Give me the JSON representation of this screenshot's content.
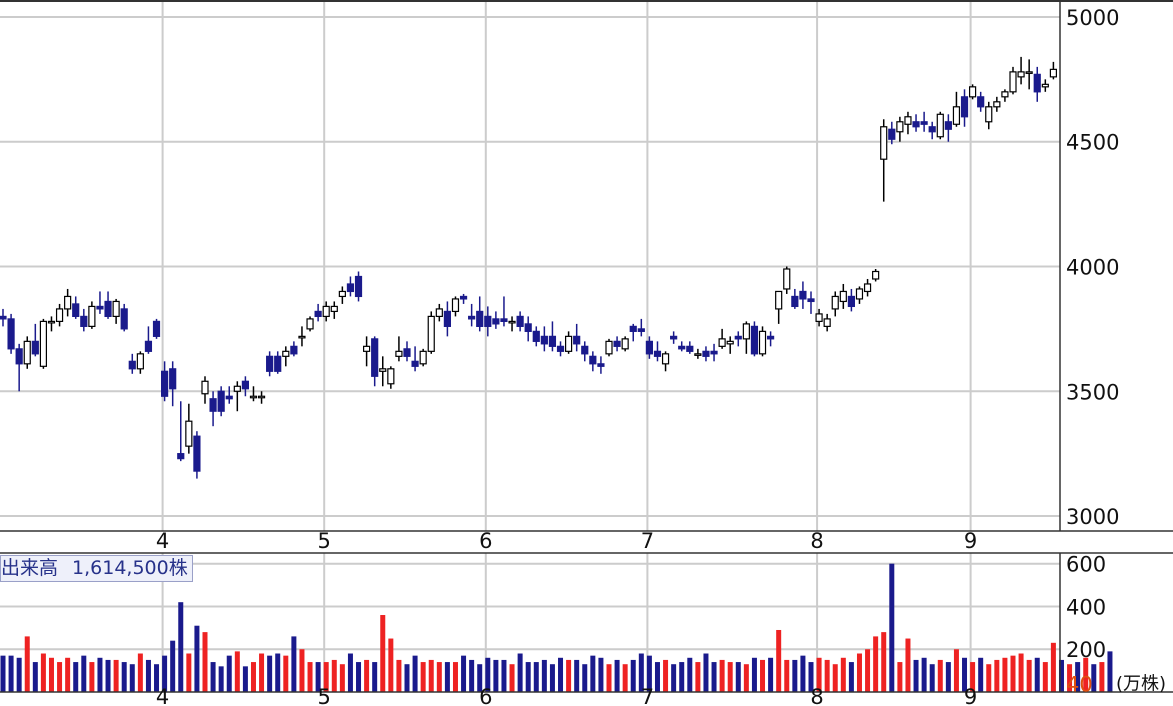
{
  "colors": {
    "up_outline": "#000000",
    "up_fill": "#ffffff",
    "down_fill": "#1a1a8c",
    "volume_up": "#ee2222",
    "volume_down": "#1a1a8c",
    "grid": "#cccccc",
    "frame": "#333333",
    "volume_unit_value": "#e05010"
  },
  "volume_label": {
    "title": "出来高",
    "value": "1,614,500株"
  },
  "volume_axis": {
    "unit_value": "40",
    "unit": "(万株)"
  },
  "chart_data": [
    {
      "type": "candlestick",
      "x_labels": [
        "4",
        "5",
        "6",
        "7",
        "8",
        "9"
      ],
      "x_label_index": [
        20,
        40,
        60,
        80,
        101,
        120
      ],
      "y_ticks": [
        3000,
        3500,
        4000,
        4500,
        5000
      ],
      "ylim": [
        2940,
        5060
      ],
      "grid": true,
      "candles_note": "open, high, low, close in yen; one per trading day",
      "candles": [
        [
          3800,
          3830,
          3760,
          3790
        ],
        [
          3790,
          3810,
          3650,
          3670
        ],
        [
          3670,
          3690,
          3500,
          3610
        ],
        [
          3610,
          3720,
          3590,
          3700
        ],
        [
          3700,
          3770,
          3640,
          3650
        ],
        [
          3600,
          3790,
          3590,
          3780
        ],
        [
          3780,
          3800,
          3740,
          3780
        ],
        [
          3780,
          3850,
          3760,
          3830
        ],
        [
          3830,
          3910,
          3800,
          3880
        ],
        [
          3850,
          3880,
          3790,
          3800
        ],
        [
          3800,
          3830,
          3740,
          3760
        ],
        [
          3760,
          3860,
          3750,
          3840
        ],
        [
          3840,
          3900,
          3810,
          3830
        ],
        [
          3860,
          3900,
          3790,
          3800
        ],
        [
          3800,
          3870,
          3770,
          3860
        ],
        [
          3830,
          3850,
          3740,
          3750
        ],
        [
          3620,
          3650,
          3570,
          3590
        ],
        [
          3590,
          3660,
          3570,
          3650
        ],
        [
          3700,
          3760,
          3650,
          3660
        ],
        [
          3780,
          3790,
          3710,
          3720
        ],
        [
          3580,
          3620,
          3460,
          3480
        ],
        [
          3590,
          3620,
          3440,
          3510
        ],
        [
          3250,
          3460,
          3220,
          3230
        ],
        [
          3280,
          3450,
          3250,
          3380
        ],
        [
          3320,
          3340,
          3150,
          3180
        ],
        [
          3490,
          3560,
          3450,
          3540
        ],
        [
          3470,
          3500,
          3360,
          3420
        ],
        [
          3500,
          3520,
          3400,
          3420
        ],
        [
          3480,
          3520,
          3450,
          3470
        ],
        [
          3500,
          3540,
          3420,
          3520
        ],
        [
          3540,
          3560,
          3480,
          3510
        ],
        [
          3480,
          3520,
          3460,
          3480
        ],
        [
          3480,
          3500,
          3450,
          3480
        ],
        [
          3640,
          3660,
          3560,
          3580
        ],
        [
          3640,
          3660,
          3570,
          3580
        ],
        [
          3640,
          3680,
          3600,
          3660
        ],
        [
          3680,
          3700,
          3640,
          3650
        ],
        [
          3720,
          3760,
          3680,
          3720
        ],
        [
          3750,
          3800,
          3740,
          3790
        ],
        [
          3820,
          3850,
          3780,
          3800
        ],
        [
          3800,
          3860,
          3780,
          3840
        ],
        [
          3820,
          3860,
          3790,
          3840
        ],
        [
          3880,
          3920,
          3850,
          3900
        ],
        [
          3930,
          3960,
          3880,
          3900
        ],
        [
          3960,
          3980,
          3860,
          3880
        ],
        [
          3660,
          3720,
          3600,
          3680
        ],
        [
          3710,
          3720,
          3520,
          3560
        ],
        [
          3580,
          3640,
          3520,
          3590
        ],
        [
          3530,
          3600,
          3510,
          3590
        ],
        [
          3640,
          3720,
          3620,
          3660
        ],
        [
          3670,
          3700,
          3620,
          3640
        ],
        [
          3620,
          3680,
          3580,
          3600
        ],
        [
          3610,
          3670,
          3600,
          3660
        ],
        [
          3660,
          3820,
          3650,
          3800
        ],
        [
          3800,
          3850,
          3780,
          3830
        ],
        [
          3820,
          3860,
          3720,
          3760
        ],
        [
          3820,
          3880,
          3800,
          3870
        ],
        [
          3880,
          3890,
          3850,
          3870
        ],
        [
          3800,
          3850,
          3760,
          3790
        ],
        [
          3820,
          3880,
          3740,
          3760
        ],
        [
          3800,
          3840,
          3720,
          3760
        ],
        [
          3790,
          3820,
          3750,
          3770
        ],
        [
          3790,
          3880,
          3760,
          3780
        ],
        [
          3780,
          3800,
          3740,
          3780
        ],
        [
          3800,
          3820,
          3740,
          3760
        ],
        [
          3770,
          3800,
          3700,
          3740
        ],
        [
          3740,
          3760,
          3680,
          3700
        ],
        [
          3720,
          3760,
          3660,
          3690
        ],
        [
          3720,
          3780,
          3660,
          3680
        ],
        [
          3680,
          3700,
          3640,
          3660
        ],
        [
          3660,
          3740,
          3650,
          3720
        ],
        [
          3720,
          3770,
          3660,
          3690
        ],
        [
          3680,
          3700,
          3620,
          3650
        ],
        [
          3640,
          3660,
          3580,
          3610
        ],
        [
          3610,
          3640,
          3570,
          3600
        ],
        [
          3650,
          3710,
          3640,
          3700
        ],
        [
          3700,
          3720,
          3660,
          3680
        ],
        [
          3670,
          3720,
          3660,
          3710
        ],
        [
          3760,
          3770,
          3700,
          3740
        ],
        [
          3750,
          3790,
          3720,
          3740
        ],
        [
          3700,
          3720,
          3630,
          3650
        ],
        [
          3660,
          3700,
          3620,
          3640
        ],
        [
          3610,
          3660,
          3580,
          3650
        ],
        [
          3720,
          3740,
          3690,
          3710
        ],
        [
          3680,
          3700,
          3660,
          3670
        ],
        [
          3680,
          3700,
          3650,
          3660
        ],
        [
          3650,
          3670,
          3630,
          3650
        ],
        [
          3660,
          3680,
          3620,
          3640
        ],
        [
          3660,
          3690,
          3620,
          3650
        ],
        [
          3680,
          3750,
          3670,
          3710
        ],
        [
          3690,
          3720,
          3650,
          3700
        ],
        [
          3720,
          3740,
          3680,
          3710
        ],
        [
          3710,
          3780,
          3650,
          3770
        ],
        [
          3760,
          3780,
          3640,
          3650
        ],
        [
          3650,
          3760,
          3640,
          3740
        ],
        [
          3720,
          3740,
          3680,
          3710
        ],
        [
          3830,
          3900,
          3770,
          3900
        ],
        [
          3910,
          4000,
          3890,
          3990
        ],
        [
          3880,
          3910,
          3830,
          3840
        ],
        [
          3900,
          3940,
          3830,
          3870
        ],
        [
          3870,
          3900,
          3810,
          3860
        ],
        [
          3780,
          3830,
          3760,
          3810
        ],
        [
          3760,
          3810,
          3740,
          3790
        ],
        [
          3830,
          3900,
          3800,
          3880
        ],
        [
          3860,
          3930,
          3830,
          3900
        ],
        [
          3880,
          3910,
          3820,
          3840
        ],
        [
          3870,
          3920,
          3850,
          3910
        ],
        [
          3900,
          3950,
          3880,
          3930
        ],
        [
          3950,
          3990,
          3940,
          3980
        ],
        [
          4430,
          4590,
          4260,
          4560
        ],
        [
          4550,
          4580,
          4490,
          4510
        ],
        [
          4540,
          4600,
          4500,
          4580
        ],
        [
          4570,
          4620,
          4530,
          4600
        ],
        [
          4580,
          4610,
          4540,
          4560
        ],
        [
          4580,
          4620,
          4540,
          4570
        ],
        [
          4560,
          4580,
          4510,
          4540
        ],
        [
          4520,
          4620,
          4510,
          4610
        ],
        [
          4580,
          4610,
          4500,
          4550
        ],
        [
          4570,
          4700,
          4560,
          4640
        ],
        [
          4680,
          4710,
          4560,
          4600
        ],
        [
          4680,
          4730,
          4670,
          4720
        ],
        [
          4680,
          4700,
          4620,
          4640
        ],
        [
          4580,
          4660,
          4550,
          4640
        ],
        [
          4640,
          4680,
          4620,
          4660
        ],
        [
          4680,
          4710,
          4660,
          4700
        ],
        [
          4700,
          4800,
          4690,
          4780
        ],
        [
          4760,
          4840,
          4730,
          4780
        ],
        [
          4780,
          4830,
          4710,
          4780
        ],
        [
          4770,
          4800,
          4660,
          4700
        ],
        [
          4720,
          4750,
          4700,
          4730
        ],
        [
          4760,
          4820,
          4750,
          4790
        ]
      ]
    },
    {
      "type": "bar",
      "title": "出来高",
      "unit": "万株",
      "y_ticks": [
        40,
        200,
        400,
        600
      ],
      "ylim": [
        0,
        650
      ],
      "values": [
        170,
        170,
        160,
        260,
        140,
        180,
        160,
        140,
        160,
        140,
        170,
        140,
        160,
        150,
        150,
        140,
        130,
        180,
        150,
        130,
        170,
        240,
        420,
        180,
        310,
        280,
        140,
        120,
        170,
        190,
        120,
        140,
        180,
        170,
        180,
        170,
        260,
        200,
        140,
        140,
        140,
        150,
        130,
        180,
        140,
        150,
        140,
        360,
        250,
        150,
        130,
        170,
        140,
        150,
        140,
        140,
        140,
        170,
        150,
        130,
        160,
        150,
        150,
        130,
        180,
        140,
        140,
        150,
        130,
        160,
        150,
        150,
        130,
        170,
        160,
        130,
        150,
        130,
        150,
        180,
        170,
        140,
        150,
        130,
        140,
        160,
        140,
        180,
        140,
        150,
        140,
        140,
        130,
        160,
        150,
        160,
        290,
        150,
        150,
        170,
        140,
        160,
        150,
        130,
        160,
        140,
        180,
        200,
        260,
        280,
        600,
        140,
        250,
        150,
        160,
        130,
        150,
        140,
        200,
        160,
        140,
        160,
        130,
        150,
        160,
        170,
        180,
        150,
        160,
        140,
        230,
        150,
        130,
        140,
        160,
        130,
        140,
        190
      ]
    }
  ]
}
